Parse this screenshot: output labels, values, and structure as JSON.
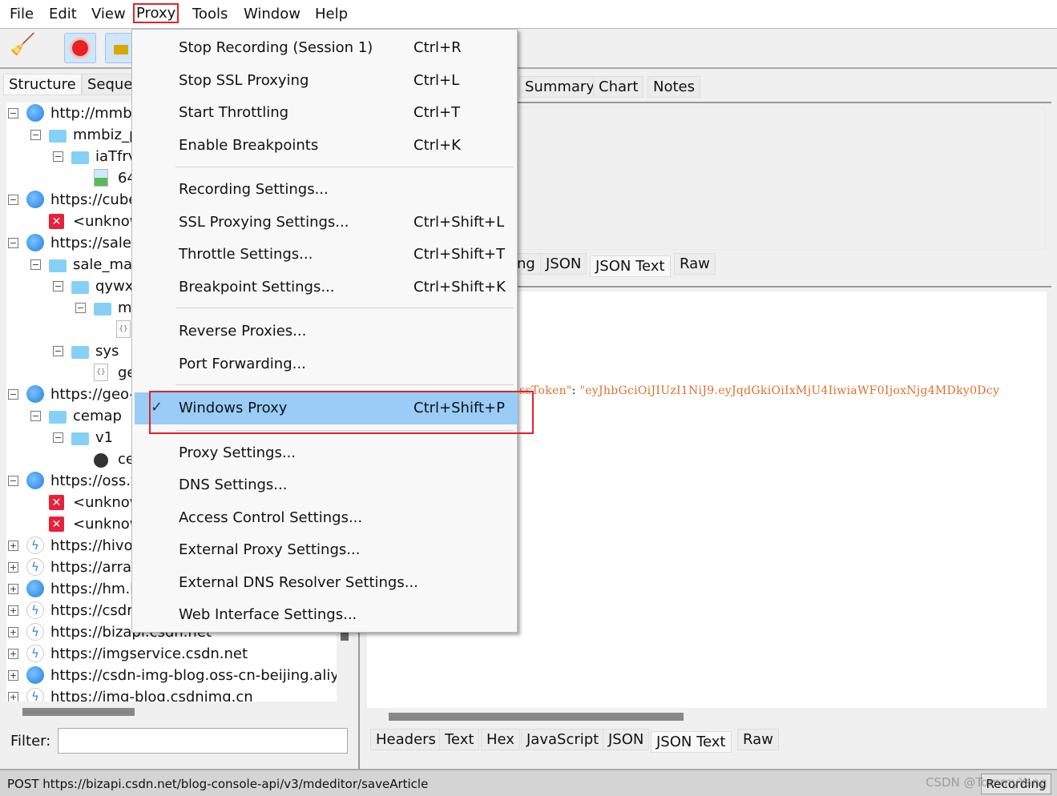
{
  "menubar": [
    "File",
    "Edit",
    "View",
    "Proxy",
    "Tools",
    "Window",
    "Help"
  ],
  "left_tabs": [
    "Structure",
    "Seque"
  ],
  "tree": [
    {
      "level": 0,
      "toggle": "minus",
      "icon": "globe",
      "text": "http://mmb"
    },
    {
      "level": 1,
      "toggle": "minus",
      "icon": "folder",
      "text": "mmbiz_p"
    },
    {
      "level": 2,
      "toggle": "minus",
      "icon": "folder",
      "text": "iaTfrv"
    },
    {
      "level": 3,
      "toggle": "",
      "icon": "image",
      "text": "64"
    },
    {
      "level": 0,
      "toggle": "minus",
      "icon": "globe",
      "text": "https://cube"
    },
    {
      "level": 1,
      "toggle": "",
      "icon": "error",
      "text": "<unknow"
    },
    {
      "level": 0,
      "toggle": "minus",
      "icon": "globe",
      "text": "https://sale."
    },
    {
      "level": 1,
      "toggle": "minus",
      "icon": "folder",
      "text": "sale_mar"
    },
    {
      "level": 2,
      "toggle": "minus",
      "icon": "folder",
      "text": "qywx"
    },
    {
      "level": 3,
      "toggle": "minus",
      "icon": "folder",
      "text": "m"
    },
    {
      "level": 4,
      "toggle": "",
      "icon": "json",
      "text": ""
    },
    {
      "level": 2,
      "toggle": "minus",
      "icon": "folder",
      "text": "sys"
    },
    {
      "level": 3,
      "toggle": "",
      "icon": "json",
      "text": "ge"
    },
    {
      "level": 0,
      "toggle": "minus",
      "icon": "globe",
      "text": "https://geo-"
    },
    {
      "level": 1,
      "toggle": "minus",
      "icon": "folder",
      "text": "cemap"
    },
    {
      "level": 2,
      "toggle": "minus",
      "icon": "folder",
      "text": "v1"
    },
    {
      "level": 3,
      "toggle": "",
      "icon": "bomb",
      "text": "ce"
    },
    {
      "level": 0,
      "toggle": "minus",
      "icon": "globe",
      "text": "https://oss.v"
    },
    {
      "level": 1,
      "toggle": "",
      "icon": "error",
      "text": "<unknow"
    },
    {
      "level": 1,
      "toggle": "",
      "icon": "error",
      "text": "<unknow"
    },
    {
      "level": 0,
      "toggle": "plus",
      "icon": "bolt",
      "text": "https://hivo"
    },
    {
      "level": 0,
      "toggle": "plus",
      "icon": "bolt",
      "text": "https://arra"
    },
    {
      "level": 0,
      "toggle": "plus",
      "icon": "globe",
      "text": "https://hm.l"
    },
    {
      "level": 0,
      "toggle": "plus",
      "icon": "bolt",
      "text": "https://csdr"
    },
    {
      "level": 0,
      "toggle": "plus",
      "icon": "bolt",
      "text": "https://bizapi.csdn.net"
    },
    {
      "level": 0,
      "toggle": "plus",
      "icon": "bolt",
      "text": "https://imgservice.csdn.net"
    },
    {
      "level": 0,
      "toggle": "plus",
      "icon": "globe",
      "text": "https://csdn-img-blog.oss-cn-beijing.aliy"
    },
    {
      "level": 0,
      "toggle": "plus",
      "icon": "bolt",
      "text": "https://img-blog.csdnimg.cn"
    }
  ],
  "filter": {
    "label": "Filter:",
    "value": ""
  },
  "top_tabs": [
    "Summary",
    "Chart",
    "Notes"
  ],
  "request_tabs": [
    "ng",
    "JSON",
    "JSON Text",
    "Raw"
  ],
  "response_tabs": [
    "Headers",
    "Text",
    "Hex",
    "JavaScript",
    "JSON",
    "JSON Text",
    "Raw"
  ],
  "json_line": {
    "key": "ssToken\"",
    "colon": ": ",
    "value": "\"eyJhbGciOiJIUzI1NiJ9.eyJqdGkiOiIxMjU4IiwiaWF0IjoxNjg4MDky0Dcy"
  },
  "menu": [
    {
      "label": "Stop Recording (Session 1)",
      "shortcut": "Ctrl+R"
    },
    {
      "label": "Stop SSL Proxying",
      "shortcut": "Ctrl+L"
    },
    {
      "label": "Start Throttling",
      "shortcut": "Ctrl+T"
    },
    {
      "label": "Enable Breakpoints",
      "shortcut": "Ctrl+K"
    },
    {
      "label": "Recording Settings...",
      "shortcut": ""
    },
    {
      "label": "SSL Proxying Settings...",
      "shortcut": "Ctrl+Shift+L"
    },
    {
      "label": "Throttle Settings...",
      "shortcut": "Ctrl+Shift+T"
    },
    {
      "label": "Breakpoint Settings...",
      "shortcut": "Ctrl+Shift+K"
    },
    {
      "label": "Reverse Proxies...",
      "shortcut": ""
    },
    {
      "label": "Port Forwarding...",
      "shortcut": ""
    },
    {
      "label": "Windows Proxy",
      "shortcut": "Ctrl+Shift+P",
      "checked": true
    },
    {
      "label": "Proxy Settings...",
      "shortcut": ""
    },
    {
      "label": "DNS Settings...",
      "shortcut": ""
    },
    {
      "label": "Access Control Settings...",
      "shortcut": ""
    },
    {
      "label": "External Proxy Settings...",
      "shortcut": ""
    },
    {
      "label": "External DNS Resolver Settings...",
      "shortcut": ""
    },
    {
      "label": "Web Interface Settings...",
      "shortcut": ""
    }
  ],
  "status": {
    "text": "POST https://bizapi.csdn.net/blog-console-api/v3/mdeditor/saveArticle",
    "button": "Recording",
    "watermark": "CSDN @TommyYang"
  },
  "colors": {
    "highlight": "#99ccf7",
    "annotation": "#e8202a",
    "json_value": "#e0702a"
  }
}
